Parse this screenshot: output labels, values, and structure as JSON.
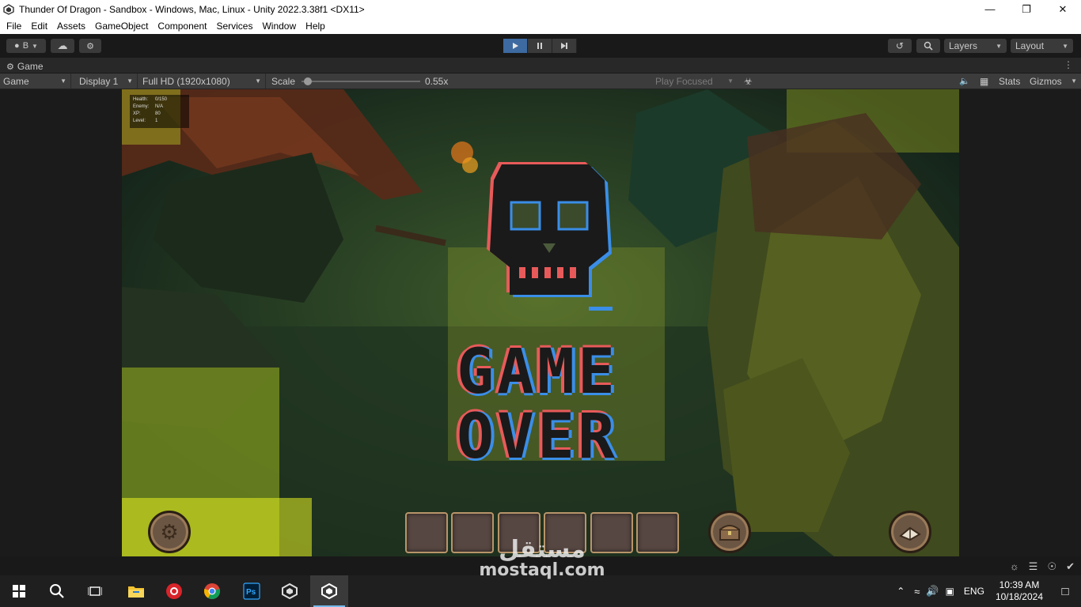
{
  "window": {
    "title": "Thunder Of Dragon - Sandbox - Windows, Mac, Linux - Unity 2022.3.38f1 <DX11>"
  },
  "menu": [
    "File",
    "Edit",
    "Assets",
    "GameObject",
    "Component",
    "Services",
    "Window",
    "Help"
  ],
  "toolbar": {
    "account_label": "B",
    "layers_label": "Layers",
    "layout_label": "Layout"
  },
  "tab": {
    "label": "Game"
  },
  "game_bar": {
    "view_mode": "Game",
    "display": "Display 1",
    "resolution": "Full HD (1920x1080)",
    "scale_label": "Scale",
    "scale_value": "0.55x",
    "scale_fraction": 0.02,
    "play_focused": "Play Focused",
    "stats_label": "Stats",
    "gizmos_label": "Gizmos"
  },
  "hud": {
    "rows": [
      {
        "key": "Health:",
        "value": "0/150"
      },
      {
        "key": "Enemy:",
        "value": "N/A"
      },
      {
        "key": "XP:",
        "value": "80"
      },
      {
        "key": "Level:",
        "value": "1"
      }
    ]
  },
  "game_over": {
    "line1": "GAME",
    "line2": "OVER"
  },
  "inventory_slots": 6,
  "taskbar": {
    "language": "ENG",
    "time": "10:39 AM",
    "date": "10/18/2024"
  },
  "watermark": {
    "arabic": "مستقل",
    "latin": "mostaql.com"
  },
  "colors": {
    "play_active": "#3d6aa0",
    "glitch_red": "#e85a5a",
    "glitch_blue": "#3a8ee8",
    "slot_border": "#b8956a"
  }
}
